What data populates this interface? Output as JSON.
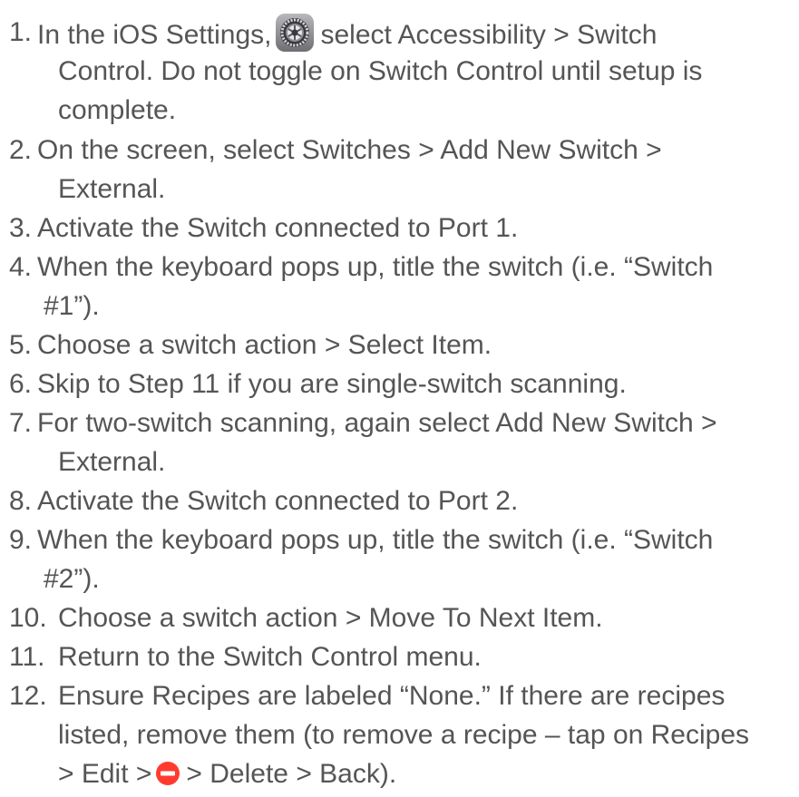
{
  "steps": [
    {
      "number": "1.",
      "lines": [
        "In the iOS Settings,",
        "select Accessibility > Switch",
        "Control. Do not toggle on Switch Control until setup is",
        "complete."
      ]
    },
    {
      "number": "2.",
      "lines": [
        "On the screen, select Switches > Add New Switch >",
        "External."
      ]
    },
    {
      "number": "3.",
      "lines": [
        "Activate the Switch connected to Port 1."
      ]
    },
    {
      "number": "4.",
      "lines": [
        "When the keyboard pops up, title the switch (i.e. “Switch",
        "#1”)."
      ]
    },
    {
      "number": "5.",
      "lines": [
        "Choose a switch action > Select Item."
      ]
    },
    {
      "number": "6.",
      "lines": [
        "Skip to Step 11 if you are single-switch scanning."
      ]
    },
    {
      "number": "7.",
      "lines": [
        "For two-switch scanning, again select Add New Switch >",
        "External."
      ]
    },
    {
      "number": "8.",
      "lines": [
        "Activate the Switch connected to Port 2."
      ]
    },
    {
      "number": "9.",
      "lines": [
        "When the keyboard pops up, title the switch (i.e. “Switch",
        "#2”)."
      ]
    },
    {
      "number": "10.",
      "lines": [
        "Choose a switch action > Move To Next Item."
      ]
    },
    {
      "number": "11.",
      "lines": [
        "Return to the Switch Control menu."
      ]
    },
    {
      "number": "12.",
      "lines": [
        "Ensure Recipes are labeled “None.” If there are recipes",
        "listed, remove them (to remove a recipe – tap on Recipes",
        "> Edit >",
        "> Delete > Back)."
      ]
    }
  ],
  "icons": {
    "settings": "settings-gear-icon",
    "delete": "delete-minus-icon"
  },
  "colors": {
    "text": "#555555",
    "delete_red": "#ff3b30",
    "settings_gray": "#8e8e93"
  }
}
